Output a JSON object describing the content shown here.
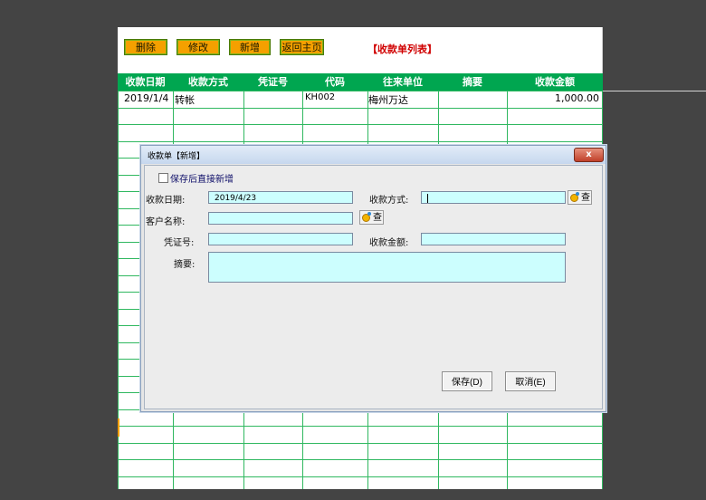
{
  "toolbar": {
    "delete_label": "删除",
    "edit_label": "修改",
    "add_label": "新增",
    "home_label": "返回主页"
  },
  "sheet_title": "【收款单列表】",
  "grid": {
    "columns": [
      "收款日期",
      "收款方式",
      "凭证号",
      "代码",
      "往来单位",
      "摘要",
      "收款金额"
    ],
    "rows": [
      {
        "date": "2019/1/4",
        "method": "转帐",
        "voucher": "",
        "code": "KH002",
        "partner": "梅州万达",
        "summary": "",
        "amount": "1,000.00"
      }
    ]
  },
  "dialog": {
    "title": "收款单【新增】",
    "close_label": "x",
    "save_then_add_label": "保存后直接新增",
    "save_then_add_checked": false,
    "date_label": "收款日期:",
    "date_value": "2019/4/23",
    "method_label": "收款方式:",
    "method_value": "",
    "customer_label": "客户名称:",
    "customer_value": "",
    "voucher_label": "凭证号:",
    "voucher_value": "",
    "amount_label": "收款金额:",
    "amount_value": "",
    "summary_label": "摘要:",
    "summary_value": "",
    "lookup_label": "查",
    "save_button": "保存(D)",
    "cancel_button": "取消(E)"
  },
  "colors": {
    "header_green": "#00a650",
    "button_orange": "#f5a000",
    "title_red": "#d00000",
    "input_cyan": "#ccfefe"
  }
}
